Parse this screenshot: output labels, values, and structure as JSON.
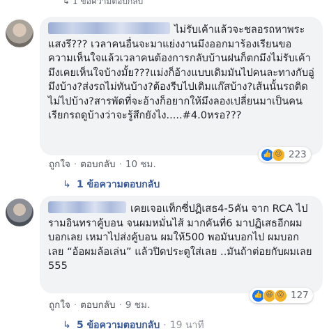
{
  "top_reply_partial": {
    "icon": "reply-arrow-icon",
    "label": "1 ข้อความตอบกลับ"
  },
  "comments": [
    {
      "text": "ไม่รับเค้าแล้วจะชลอรถหาพระแสงรึ??? เวลาคนอื่นจะมาแย่งงานมึงออกมาร้องเรียนขอความเห็นใจแล้วเวลาคนต้องการกลับบ้านฝนก็ตกมึงไม่รับเค้ามึงเคยเห็นใจบ้างมั้ย???แม่งก็อ้างแบบเดิมมันไปคนละทางกับอู่มึงบ้าง?ส่งรถไม่ทันบ้าง?ต้องรีบไปเติมแก๊สบ้าง?เส้นนั้นรถติดไม่ไปบ้าง?สารพัดที่จะอ้างก็อยากให้มึงลองเปลี่ยนมาเป็นคนเรียกรถดูบ้างว่าจะรู้สึกยังไง.....#4.0หรอ???",
      "actions": {
        "like": "ถูกใจ",
        "reply": "ตอบกลับ",
        "time": "10 ชม."
      },
      "reactions": {
        "icons": [
          "like-icon",
          "sad-icon"
        ],
        "count": "223"
      },
      "replies": {
        "icon": "reply-arrow-icon",
        "label": "1 ข้อความตอบกลับ"
      }
    },
    {
      "text": "เคยเจอแท็กซี่ปฏิเสธ4-5คัน จาก RCA ไป รามอินทราคู้บอน จนผมหมั่นไส้ มากคันที่6 มาปฏิเสธอีกผมบอกเลย เหมาไปส่งคู้บอน ผมให้500 พอมันบอกไป ผมบอกเลย “อ้อผมล้อเล่น” แล้วปิดประตูใส่เลย ..มันถ้าต่อยกับผมเลย 555",
      "actions": {
        "like": "ถูกใจ",
        "reply": "ตอบกลับ",
        "time": "9 ชม."
      },
      "reactions": {
        "icons": [
          "like-icon",
          "haha-icon",
          "wow-icon"
        ],
        "count": "127"
      },
      "replies": {
        "icon": "reply-arrow-icon",
        "label": "5 ข้อความตอบกลับ",
        "time": "19 นาที"
      }
    }
  ],
  "colors": {
    "link": "#385898",
    "bubble": "#f2f3f5",
    "like": "#1877f2",
    "emoji": "#f7b125"
  }
}
